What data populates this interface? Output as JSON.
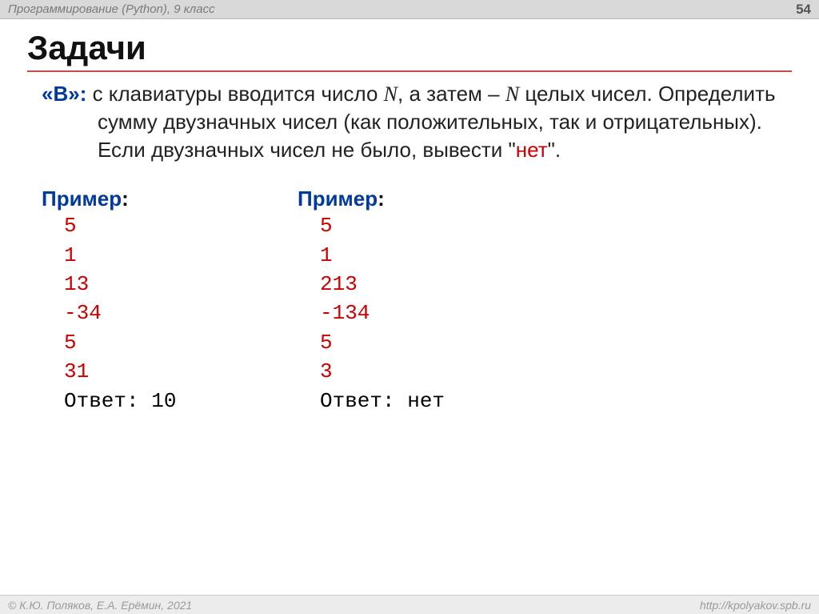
{
  "header": {
    "course": "Программирование (Python), 9 класс",
    "page_number": "54"
  },
  "title": "Задачи",
  "task": {
    "badge": "«B»:",
    "line1_a": " с клавиатуры вводится число ",
    "line1_var1": "N",
    "line1_b": ", а затем – ",
    "line1_var2": "N",
    "line1_c": " целых чисел. Определить сумму двузначных чисел (как положительных, так и отрицательных). Если двузначных чисел не было, вывести \"",
    "line1_net": "нет",
    "line1_end": "\"."
  },
  "examples": [
    {
      "label": "Пример",
      "colon": ":",
      "inputs": [
        "5",
        "1",
        "13",
        "-34",
        "5",
        "31"
      ],
      "answer_label": "Ответ: ",
      "answer_value": "10"
    },
    {
      "label": "Пример",
      "colon": ":",
      "inputs": [
        "5",
        "1",
        "213",
        "-134",
        "5",
        "3"
      ],
      "answer_label": "Ответ: ",
      "answer_value": "нет"
    }
  ],
  "footer": {
    "left": "© К.Ю. Поляков, Е.А. Ерёмин, 2021",
    "right": "http://kpolyakov.spb.ru"
  }
}
